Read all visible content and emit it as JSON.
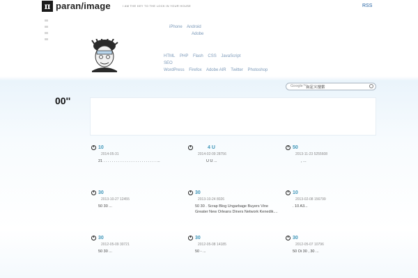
{
  "header": {
    "logo_glyph": "π",
    "logo_text": "paran/image",
    "tagline": "I AM THE KEY TO THE LOCK IN YOUR HOUSE",
    "rss_label": "RSS"
  },
  "nav": {
    "row1": [
      "iPhone",
      "Android"
    ],
    "row2": [
      "Adobe"
    ],
    "row3": [
      "HTML",
      "PHP",
      "Flash",
      "CSS",
      "JavaScript"
    ],
    "row4": [
      "SEO"
    ],
    "row5": [
      "WordPress",
      "Firefox",
      "Adobe AIR",
      "Twitter",
      "Photoshop"
    ]
  },
  "search": {
    "brand": "Google™",
    "placeholder": "自定义搜索"
  },
  "section": {
    "title": "00''"
  },
  "posts": [
    {
      "title": "10",
      "meta": "2014-05-31",
      "excerpt": "21 . . . . . . . . . . . . . . . . . . . . . . . . . ..."
    },
    {
      "title": "4  U",
      "meta": "2014-02-09 28756",
      "excerpt": "U       U                                              ..."
    },
    {
      "title": "50",
      "meta": "2013-11-23 5255608",
      "excerpt": ",                                                     ..."
    },
    {
      "title": "30",
      "meta": "2013-10-27 12455",
      "excerpt": "50                    30                              ..."
    },
    {
      "title": "30",
      "meta": "2013-10-24 8026",
      "excerpt": "50      30            . Scrap Blog Ungarbage Buyers Vine Greater New Orleans Diners Network Kenedik...."
    },
    {
      "title": "10",
      "meta": "2013-02-08 156799",
      "excerpt": ".                                      10       A3..."
    },
    {
      "title": "30",
      "meta": "2012-05-09 30721",
      "excerpt": "50          30                                        ..."
    },
    {
      "title": "30",
      "meta": "2012-05-08 14185",
      "excerpt": "50                                -                   ..."
    },
    {
      "title": "30",
      "meta": "2012-05-07 10796",
      "excerpt": "50               Oi     30         ,         30      ..."
    }
  ]
}
